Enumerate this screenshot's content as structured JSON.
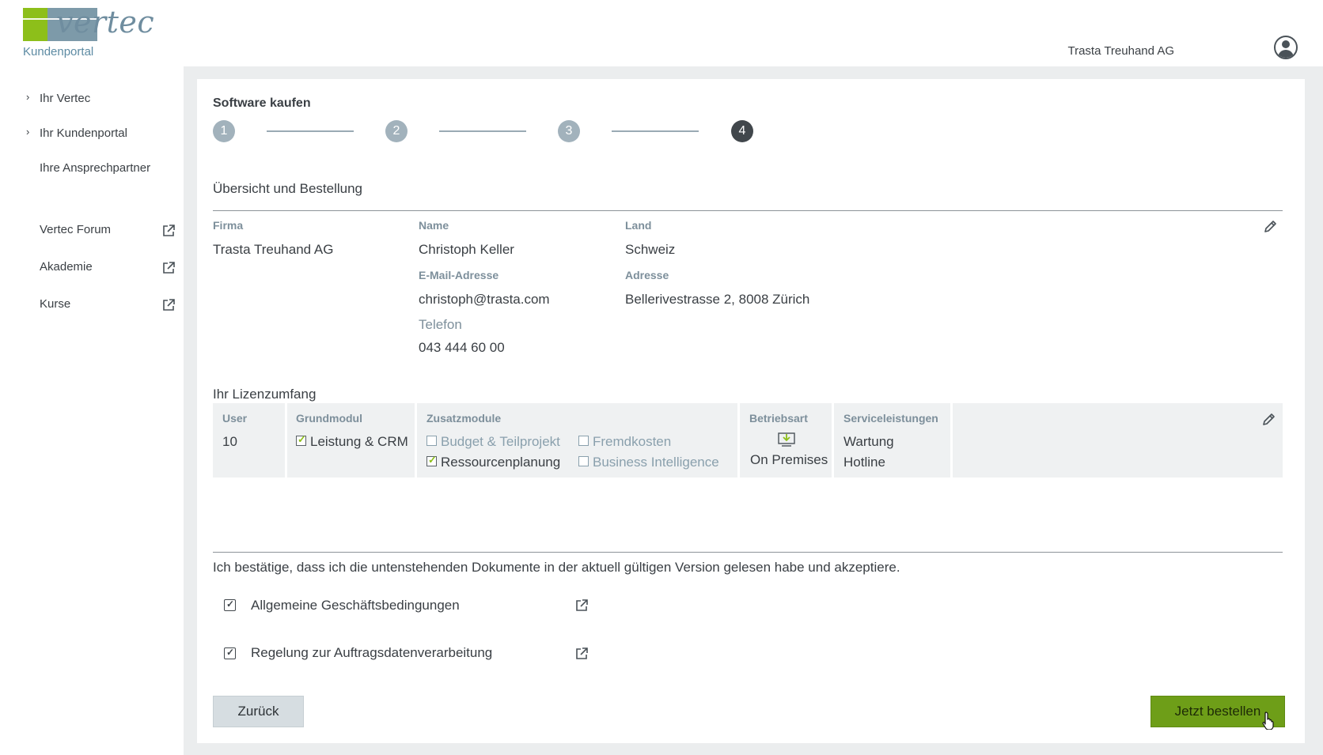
{
  "header": {
    "logo_text": "vertec",
    "portal_label": "Kundenportal",
    "user_name": "Trasta Treuhand AG"
  },
  "sidebar": {
    "items": [
      {
        "label": "Ihr Vertec",
        "has_chevron": true
      },
      {
        "label": "Ihr Kundenportal",
        "has_chevron": true
      },
      {
        "label": "Ihre Ansprechpartner",
        "has_chevron": false
      }
    ],
    "external_links": [
      {
        "label": "Vertec Forum",
        "icon": "external-link-icon"
      },
      {
        "label": "Akademie",
        "icon": "external-link-icon"
      },
      {
        "label": "Kurse",
        "icon": "external-link-icon"
      }
    ]
  },
  "main": {
    "title": "Software kaufen",
    "steps": [
      "1",
      "2",
      "3",
      "4"
    ],
    "active_step": "4",
    "overview_title": "Übersicht und Bestellung",
    "contact": {
      "firma_label": "Firma",
      "firma_value": "Trasta Treuhand AG",
      "name_label": "Name",
      "name_value": "Christoph Keller",
      "land_label": "Land",
      "land_value": "Schweiz",
      "email_label": "E-Mail-Adresse",
      "email_value": "christoph@trasta.com",
      "adresse_label": "Adresse",
      "adresse_value": "Bellerivestrasse 2, 8008 Zürich",
      "telefon_label": "Telefon",
      "telefon_value": "043 444 60 00"
    },
    "license": {
      "title": "Ihr Lizenzumfang",
      "user_label": "User",
      "user_value": "10",
      "grundmodul_label": "Grundmodul",
      "grundmodul_value": "Leistung & CRM",
      "zusatz_label": "Zusatzmodule",
      "zusatz": [
        {
          "label": "Budget & Teilprojekt",
          "checked": false
        },
        {
          "label": "Fremdkosten",
          "checked": false
        },
        {
          "label": "Ressourcenplanung",
          "checked": true
        },
        {
          "label": "Business Intelligence",
          "checked": false
        }
      ],
      "betriebsart_label": "Betriebsart",
      "betriebsart_value": "On Premises",
      "service_label": "Serviceleistungen",
      "service_values": [
        "Wartung",
        "Hotline"
      ]
    },
    "confirm_text": "Ich bestätige, dass ich die untenstehenden Dokumente in der aktuell gültigen Version gelesen habe und akzeptiere.",
    "documents": [
      {
        "label": "Allgemeine Geschäftsbedingungen",
        "checked": true
      },
      {
        "label": "Regelung zur Auftragsdatenverarbeitung",
        "checked": true
      }
    ],
    "back_label": "Zurück",
    "order_label": "Jetzt bestellen"
  },
  "colors": {
    "accent_green": "#6e9e18",
    "logo_green": "#8dbf1a",
    "logo_grey": "#7d9aa9",
    "step_active": "#41474c",
    "step_inactive": "#a2b2bc"
  }
}
